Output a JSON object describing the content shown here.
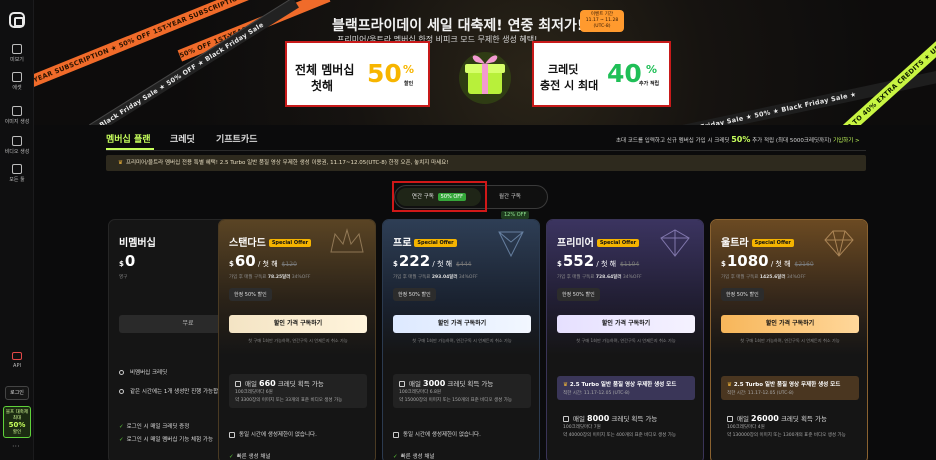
{
  "sidebar": {
    "items": [
      {
        "label": "미보기",
        "icon": "compass-icon"
      },
      {
        "label": "에셋",
        "icon": "asset-icon"
      },
      {
        "label": "이미지 생성",
        "icon": "image-icon"
      },
      {
        "label": "비디오 생성",
        "icon": "video-icon"
      },
      {
        "label": "모든 툴",
        "icon": "grid-icon"
      }
    ],
    "api_label": "API",
    "login_label": "로그인",
    "promo": {
      "line1": "블프 대축제",
      "line2": "최대",
      "line3": "50%",
      "line4": "할인"
    },
    "more": "···"
  },
  "banner": {
    "title": "블랙프라이데이 세일 대축제! 연중 최저가!",
    "subtitle": "프리미어/울트라 멤버십 한정 비피크 모드 무제한 생성 혜택!",
    "event_badge": {
      "line1": "이벤트 기간",
      "line2": "11.17 ~ 11.28",
      "line3": "(UTC-8)"
    },
    "ribbons": [
      "50% OFF 1ST-YEAR SUBSCRIPTION ★ 50% OFF 1ST-YEAR SUBSCRIPTION",
      "★ Black Friday Sale ★ 50% OFF ★ Black Friday Sale",
      "★ UP TO 40% EXTRA CREDITS ★ UP TO 40% EXTRA CREDITS",
      "Black Friday Sale ★ 50% ★ Black Friday Sale ★",
      "50% OFF 1ST-YEAR SUBS"
    ],
    "offer_membership": {
      "line1": "전체 멤버십",
      "line2": "첫해",
      "big": "50",
      "pct": "%",
      "small": "할인"
    },
    "offer_credit": {
      "line1": "크레딧",
      "line2": "충전 시 최대",
      "big": "40",
      "pct": "%",
      "small": "추가 적립"
    }
  },
  "tabs": [
    {
      "label": "멤버십 플랜",
      "active": true
    },
    {
      "label": "크레딧",
      "active": false
    },
    {
      "label": "기프트카드",
      "active": false
    }
  ],
  "invite": {
    "pre": "초대 코드를 입력하고 신규 멤버십 가입 시 크레딧 ",
    "highlight": "50%",
    "post": " 추가 적립 (최대 5000크레딧까지)",
    "link": "기입하기 >"
  },
  "notice": "프리미어/울트라 멤버십 전용 특별 혜택! 2.5 Turbo 일반 품질 영상 무제한 생성 이용권, 11.17~12.05(UTC-8) 한정 오픈, 놓치지 마세요!",
  "billing_toggle": {
    "annual_label": "연간 구독",
    "annual_badge": "50% OFF",
    "monthly_label": "월간 구독",
    "monthly_badge": "12% OFF"
  },
  "plans": [
    {
      "name": "비멤버십",
      "price": "0",
      "currency": "$",
      "per": "",
      "period_note": "영구",
      "button": "무료",
      "features": [
        "비멤버십 크레딧",
        "같은 시간에는 1개 생성만 진행 가능합니다.",
        "로그인 시 매일 크레딧 증정",
        "로그인 시 매일 멤버십 기능 체험 가능"
      ]
    },
    {
      "name": "스탠다드",
      "badge": "Special Offer",
      "currency": "$",
      "price": "60",
      "per": " / 첫 해",
      "old_price": "$120",
      "monthly_note_pre": "가입 후 매월 구독료 ",
      "monthly_value": "78.25달러",
      "monthly_note_post": " 34%OFF",
      "discount": "한정 50% 할인",
      "button": "할인 가격 구독하기",
      "note": "첫 구매 1회만 가능하며, 연간구독 시 언제든지 취소 가능",
      "credits": "660",
      "credit_pre": "매일 ",
      "credit_post": " 크레딧 획득 가능",
      "credit_desc1": "100크레딧마다 6원",
      "credit_desc2": "약 3300장의 이미지 또는 33개의 표준 비디오 생성 가능",
      "concurrency": "동일 시간에 생성제한이 없습니다.",
      "extra": "빠른 생성 채널"
    },
    {
      "name": "프로",
      "badge": "Special Offer",
      "currency": "$",
      "price": "222",
      "per": " / 첫 해",
      "old_price": "$444",
      "monthly_note_pre": "가입 후 매월 구독료 ",
      "monthly_value": "293.04달러",
      "monthly_note_post": " 34%OFF",
      "discount": "한정 50% 할인",
      "button": "할인 가격 구독하기",
      "note": "첫 구매 1회만 가능하며, 연간구독 시 언제든지 취소 가능",
      "credits": "3000",
      "credit_pre": "매일 ",
      "credit_post": " 크레딧 획득 가능",
      "credit_desc1": "100크레딧마다 6.8원",
      "credit_desc2": "약 15000장의 이미지 또는 150개의 표준 비디오 생성 가능",
      "concurrency": "동일 시간에 생성제한이 없습니다.",
      "extra": "빠른 생성 채널"
    },
    {
      "name": "프리미어",
      "badge": "Special Offer",
      "currency": "$",
      "price": "552",
      "per": " / 첫 해",
      "old_price": "$1104",
      "monthly_note_pre": "가입 후 매월 구독료 ",
      "monthly_value": "728.64달러",
      "monthly_note_post": " 34%OFF",
      "discount": "한정 50% 할인",
      "button": "할인 가격 구독하기",
      "note": "첫 구매 1회만 가능하며, 연간구독 시 언제든지 취소 가능",
      "highlight": "2.5 Turbo 일반 품질 영상 무제한 생성 모드",
      "highlight_date": "적한 시간: 11.17-12.05 (UTC-8)",
      "credits": "8000",
      "credit_pre": "매일 ",
      "credit_post": " 크레딧 획득 가능",
      "credit_desc1": "100크레딧마다 7원",
      "credit_desc2": "약 40000장의 이미지 또는 400개의 표준 비디오 생성 가능"
    },
    {
      "name": "울트라",
      "badge": "Special Offer",
      "currency": "$",
      "price": "1080",
      "per": " / 첫 해",
      "old_price": "$2160",
      "monthly_note_pre": "가입 후 매월 구독료 ",
      "monthly_value": "1425.6달러",
      "monthly_note_post": " 34%OFF",
      "discount": "한정 50% 할인",
      "button": "할인 가격 구독하기",
      "note": "첫 구매 1회만 가능하며, 연간구독 시 언제든지 취소 가능",
      "highlight": "2.5 Turbo 일반 품질 영상 무제한 생성 모드",
      "highlight_date": "적한 시간: 11.17-12.05 (UTC-8)",
      "credits": "26000",
      "credit_pre": "매일 ",
      "credit_post": " 크레딧 획득 가능",
      "credit_desc1": "100크레딧마다 4원",
      "credit_desc2": "약 130000장의 이미지 또는 1300개의 표준 비디오 생성 가능"
    }
  ],
  "colors": {
    "accent": "#c6ff5c",
    "standard_grad": "#5a4424",
    "pro_grad": "#2e3e55",
    "premier_grad": "#3b3460",
    "ultra_grad": "#6b4a22",
    "highlight_border": "#d01818"
  }
}
